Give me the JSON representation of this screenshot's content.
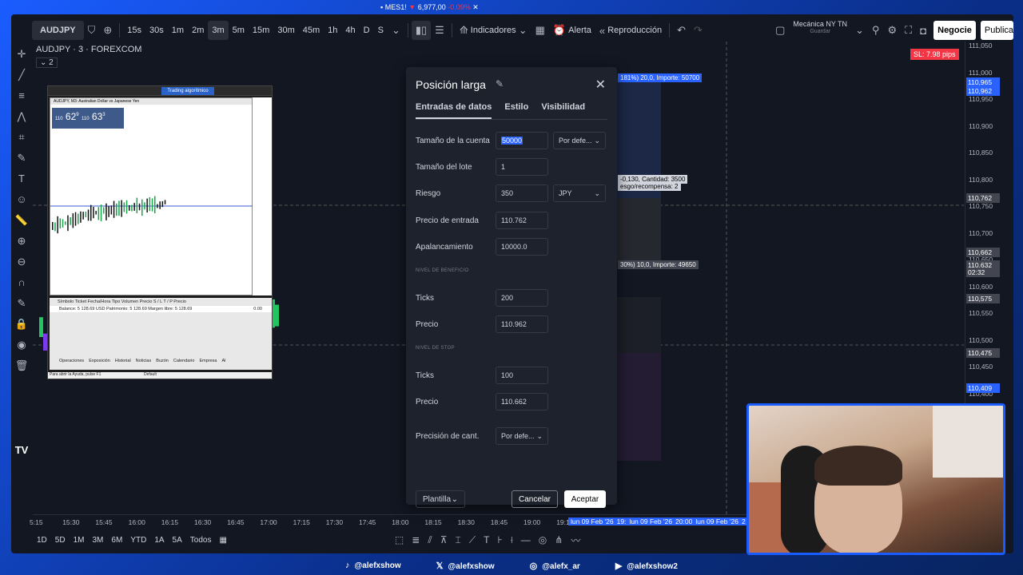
{
  "window": {
    "tab_title": "MES1! ▼ 6,977,00 -0.09%",
    "tab_symbol": "MES1!",
    "tab_price": "6,977,00",
    "tab_change": "-0.09%"
  },
  "toolbar": {
    "symbol": "AUDJPY",
    "intervals": [
      "15s",
      "30s",
      "1m",
      "2m",
      "3m",
      "5m",
      "15m",
      "30m",
      "45m",
      "1h",
      "4h",
      "D",
      "S"
    ],
    "active_interval": "3m",
    "indicators_label": "Indicadores",
    "alert_label": "Alerta",
    "replay_label": "Reproducción",
    "layout_name": "Mecánica NY TN",
    "layout_sub": "Guardar",
    "trade_label": "Negocie",
    "publish_label": "Publica"
  },
  "legend": {
    "title": "AUDJPY · 3 · FOREXCOM",
    "sub": "2"
  },
  "price_scale": {
    "labels": [
      "111,050",
      "111,000",
      "110,950",
      "110,900",
      "110,850",
      "110,800",
      "110,750",
      "110,700",
      "110,650",
      "110,600",
      "110,550",
      "110,500",
      "110,450",
      "110,400"
    ],
    "badges": [
      {
        "text": "110,965",
        "color": "#2962ff"
      },
      {
        "text": "110,962",
        "color": "#2962ff"
      },
      {
        "text": "110,762",
        "color": "#434651"
      },
      {
        "text": "110,662",
        "color": "#434651"
      },
      {
        "text": "110,632",
        "color": "#434651"
      },
      {
        "text": "02:32",
        "color": "#434651"
      },
      {
        "text": "110,575",
        "color": "#434651"
      },
      {
        "text": "110,475",
        "color": "#434651"
      },
      {
        "text": "110,409",
        "color": "#2962ff"
      }
    ],
    "sl_label": "SL: 7.98 pips"
  },
  "time_scale": {
    "labels": [
      "5:15",
      "15:30",
      "15:45",
      "16:00",
      "16:15",
      "16:30",
      "16:45",
      "17:00",
      "17:15",
      "17:30",
      "17:45",
      "18:00",
      "18:15",
      "18:30",
      "18:45",
      "19:00",
      "19:1"
    ],
    "highlight": [
      "lun 09 Feb '26",
      "19:",
      "lun 09 Feb '26",
      "20:00",
      "lun 09 Feb '26",
      "2"
    ]
  },
  "bottombar": {
    "ranges": [
      "1D",
      "5D",
      "1M",
      "3M",
      "6M",
      "YTD",
      "1A",
      "5A",
      "Todos"
    ]
  },
  "overlays": {
    "target_label": "181%) 20,0, Importe: 50700",
    "entry_label_1": "-0,130, Cantidad: 3500",
    "entry_label_2": "esgo/recompensa: 2",
    "stop_label": "30%) 10,0, Importe: 49650"
  },
  "mt4": {
    "title": "AUDJPY, M3: Australian Dollar vs Japanese Yen",
    "algo": "Trading algorítmico",
    "sell": "62",
    "sell_prefix": "110",
    "sell_sup": "9",
    "buy": "63",
    "buy_prefix": "110",
    "buy_sup": "3",
    "term_header": "Símbolo   Ticket   Fecha/Hora   Tipo   Volumen   Precio   S / L   T / P   Precio",
    "balance": "Balance: 5 128.69 USD  Patrimonio: 5 128.69  Margen libre: 5 128.69",
    "balance_value": "0.00",
    "tabs": [
      "Operaciones",
      "Exposición",
      "Historial",
      "Noticias",
      "Buzón",
      "Calendario",
      "Empresa",
      "Al"
    ],
    "help": "Para abrir la Ayuda, pulse F1",
    "default": "Default"
  },
  "dialog": {
    "title": "Posición larga",
    "tabs": [
      "Entradas de datos",
      "Estilo",
      "Visibilidad"
    ],
    "account_label": "Tamaño de la cuenta",
    "account_value": "50000",
    "account_dropdown": "Por defe...",
    "lot_label": "Tamaño del lote",
    "lot_value": "1",
    "risk_label": "Riesgo",
    "risk_value": "350",
    "risk_currency": "JPY",
    "entry_label": "Precio de entrada",
    "entry_value": "110.762",
    "leverage_label": "Apalancamiento",
    "leverage_value": "10000.0",
    "profit_section": "NIVEL DE BENEFICIO",
    "profit_ticks_label": "Ticks",
    "profit_ticks": "200",
    "profit_price_label": "Precio",
    "profit_price": "110.962",
    "stop_section": "NIVEL DE STOP",
    "stop_ticks_label": "Ticks",
    "stop_ticks": "100",
    "stop_price_label": "Precio",
    "stop_price": "110.662",
    "precision_label": "Precisión de cant.",
    "precision_value": "Por defe...",
    "template_label": "Plantilla",
    "cancel_label": "Cancelar",
    "accept_label": "Aceptar"
  },
  "social": [
    "@alefxshow",
    "@alefxshow",
    "@alefx_ar",
    "@alefxshow2"
  ]
}
